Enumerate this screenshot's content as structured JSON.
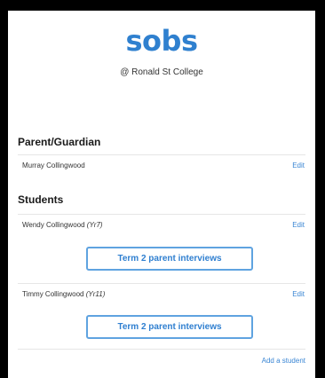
{
  "header": {
    "logo": "sobs",
    "school": "@ Ronald St College"
  },
  "parent_section": {
    "heading": "Parent/Guardian",
    "rows": [
      {
        "name": "Murray Collingwood",
        "edit": "Edit"
      }
    ]
  },
  "students_section": {
    "heading": "Students",
    "rows": [
      {
        "name": "Wendy Collingwood",
        "year": "(Yr7)",
        "edit": "Edit",
        "button": "Term 2 parent interviews"
      },
      {
        "name": "Timmy Collingwood",
        "year": "(Yr11)",
        "edit": "Edit",
        "button": "Term 2 parent interviews"
      }
    ]
  },
  "add_student": "Add a student",
  "colors": {
    "brand": "#2f80cf",
    "link": "#3a86d4",
    "button_border": "#5fa3e0"
  }
}
